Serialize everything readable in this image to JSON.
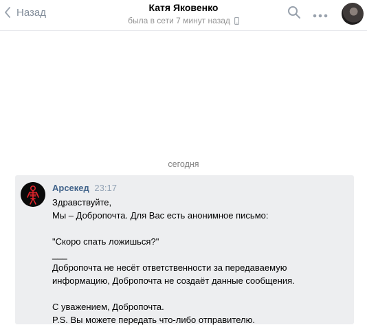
{
  "header": {
    "back_label": "Назад",
    "peer_name": "Катя Яковенко",
    "peer_status": "была в сети 7 минут назад",
    "icons": [
      "chevron-left-icon",
      "search-icon",
      "more-icon",
      "mobile-icon"
    ]
  },
  "chat": {
    "date_separator": "сегодня",
    "message": {
      "author": "Арсекед",
      "time": "23:17",
      "lines": [
        "Здравствуйте,",
        "Мы – Добропочта. Для Вас есть анонимное письмо:",
        "",
        "\"Скоро спать ложишься?\"",
        "___",
        "Добропочта не несёт ответственности за передаваемую",
        "информацию, Добропочта не создаёт данные сообщения.",
        "",
        "С уважением, Добропочта.",
        "P.S. Вы можете передать что-либо отправителю."
      ]
    }
  },
  "colors": {
    "accent": "#42648b",
    "muted": "#818c99",
    "message_bg": "#edeef0"
  }
}
